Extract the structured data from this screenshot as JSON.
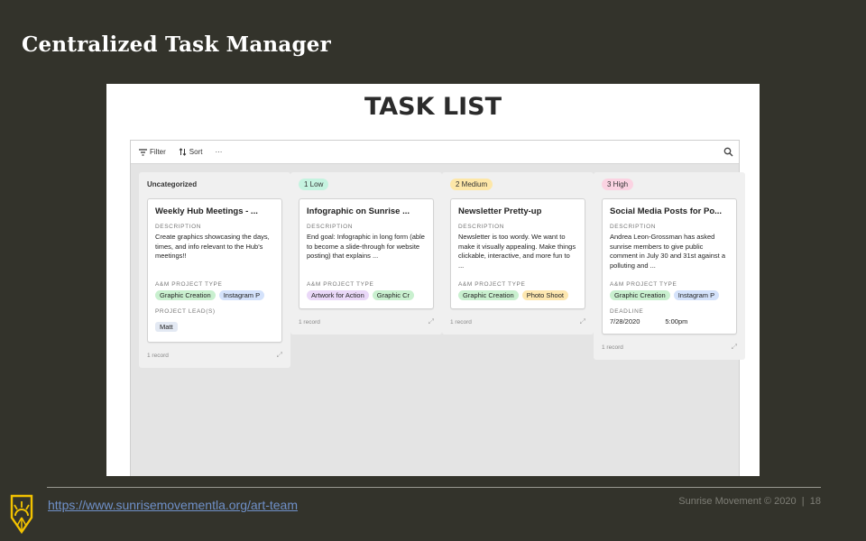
{
  "slide": {
    "title": "Centralized Task Manager",
    "link": "https://www.sunrisemovementla.org/art-team",
    "copyright": "Sunrise Movement © 2020",
    "page_number": "18"
  },
  "task_list": {
    "heading": "TASK LIST",
    "toolbar": {
      "filter_label": "Filter",
      "sort_label": "Sort",
      "more_label": "···"
    },
    "columns": [
      {
        "name": "Uncategorized",
        "pill_color": "",
        "footer": "1 record",
        "card": {
          "title": "Weekly Hub Meetings - ...",
          "description_label": "DESCRIPTION",
          "description": "Create graphics showcasing the days, times, and info relevant to the Hub's meetings!!",
          "project_type_label": "A&M PROJECT TYPE",
          "tags": [
            {
              "text": "Graphic Creation",
              "color": "#c9f0cf"
            },
            {
              "text": "Instagram P",
              "color": "#d4e2fb"
            }
          ],
          "lead_label": "PROJECT LEAD(S)",
          "lead": "Matt"
        }
      },
      {
        "name": "1 Low",
        "pill_color": "#c5f3e0",
        "footer": "1 record",
        "card": {
          "title": "Infographic on Sunrise ...",
          "description_label": "DESCRIPTION",
          "description": "End goal: Infographic in long form (able to become a slide-through for website posting) that explains ...",
          "project_type_label": "A&M PROJECT TYPE",
          "tags": [
            {
              "text": "Artwork for Action",
              "color": "#ead8f8"
            },
            {
              "text": "Graphic Cr",
              "color": "#c9f0cf"
            }
          ]
        }
      },
      {
        "name": "2 Medium",
        "pill_color": "#fde7a8",
        "footer": "1 record",
        "card": {
          "title": "Newsletter Pretty-up",
          "description_label": "DESCRIPTION",
          "description": "Newsletter is too wordy. We want to make it visually appealing. Make things clickable, interactive, and more fun to ...",
          "project_type_label": "A&M PROJECT TYPE",
          "tags": [
            {
              "text": "Graphic Creation",
              "color": "#c9f0cf"
            },
            {
              "text": "Photo Shoot",
              "color": "#fde7b0"
            }
          ]
        }
      },
      {
        "name": "3 High",
        "pill_color": "#fbd3e2",
        "footer": "1 record",
        "card": {
          "title": "Social Media Posts for Po...",
          "description_label": "DESCRIPTION",
          "description": "Andrea Leon-Grossman has asked sunrise members to give public comment in July 30 and 31st against a polluting and ...",
          "project_type_label": "A&M PROJECT TYPE",
          "tags": [
            {
              "text": "Graphic Creation",
              "color": "#c9f0cf"
            },
            {
              "text": "Instagram P",
              "color": "#d4e2fb"
            }
          ],
          "deadline_label": "DEADLINE",
          "deadline_date": "7/28/2020",
          "deadline_time": "5:00pm"
        }
      }
    ]
  },
  "icons": {
    "filter": "filter-icon",
    "sort": "sort-icon",
    "more": "more-icon",
    "search": "search-icon",
    "expand": "expand-icon",
    "logo": "sunrise-logo"
  },
  "colors": {
    "slide_bg": "#33332b",
    "board_bg": "#e4e4e4",
    "link": "#6f90c8"
  }
}
